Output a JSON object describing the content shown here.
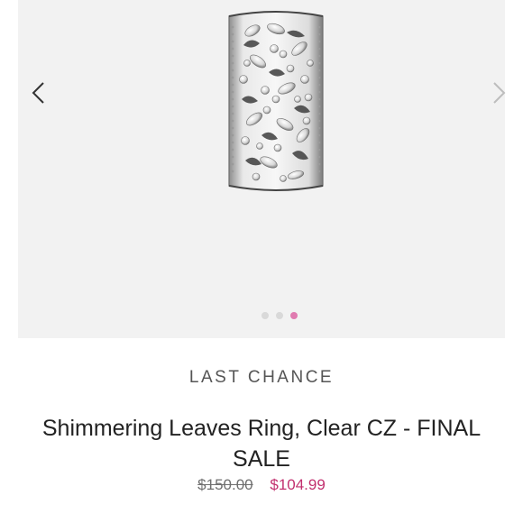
{
  "carousel": {
    "prev_icon": "chevron-left-icon",
    "next_icon": "chevron-right-icon",
    "slide_count": 3,
    "active_slide": 3,
    "active_dot_color": "#e07bb0",
    "inactive_dot_color": "#d9d9d9"
  },
  "product": {
    "category": "LAST CHANCE",
    "title": "Shimmering Leaves Ring, Clear CZ - FINAL SALE",
    "original_price": "$150.00",
    "sale_price": "$104.99",
    "sale_color": "#c2306f"
  }
}
